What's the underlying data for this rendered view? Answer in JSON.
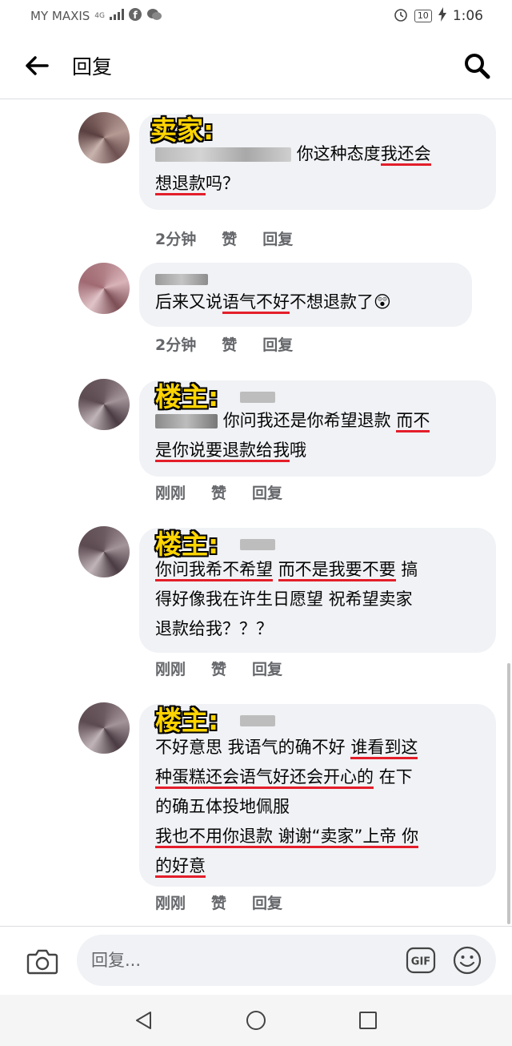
{
  "status_bar": {
    "carrier": "MY MAXIS",
    "network": "4G",
    "battery": "10",
    "time": "1:06"
  },
  "header": {
    "title": "回复",
    "back_icon": "arrow-left-icon",
    "search_icon": "search-icon"
  },
  "comments": [
    {
      "label": "卖家:",
      "text_plain_1": "你这种态度",
      "text_ul_1": "我还会",
      "text_ul_2": "想退款",
      "text_plain_2": "吗？",
      "time": "2分钟",
      "like": "赞",
      "reply": "回复"
    },
    {
      "label": "",
      "text_plain_1": "后来又说",
      "text_ul_1": "语气不好",
      "text_plain_2": "不想退款了",
      "emoji": "😲",
      "time": "2分钟",
      "like": "赞",
      "reply": "回复"
    },
    {
      "label": "楼主:",
      "text_plain_1": "你问我还是你希望退款 ",
      "text_ul_1": "而不",
      "text_ul_2": "是你说要退款给我",
      "text_plain_2": "哦",
      "time": "刚刚",
      "like": "赞",
      "reply": "回复"
    },
    {
      "label": "楼主:",
      "text_ul_1": "你问我希不希望",
      "text_plain_1": " ",
      "text_ul_2": "而不是我要不要",
      "text_plain_2": " 搞",
      "line2": "得好像我在许生日愿望 祝希望卖家",
      "line3": "退款给我？？？",
      "time": "刚刚",
      "like": "赞",
      "reply": "回复"
    },
    {
      "label": "楼主:",
      "line1_plain": "不好意思 我语气的确不好 ",
      "line1_ul": "谁看到这",
      "line2_ul": "种蛋糕还会语气好还会开心的",
      "line2_plain": " 在下",
      "line3": "的确五体投地佩服",
      "line4_ul": "我也不用你退款 谢谢“卖家”上帝 你",
      "line5_ul": "的好意",
      "time": "刚刚",
      "like": "赞",
      "reply": "回复"
    }
  ],
  "composer": {
    "placeholder": "回复...",
    "gif_label": "GIF"
  },
  "colors": {
    "bubble": "#f0f2f5",
    "underline": "#e41e2a",
    "label_yellow": "#ffd400",
    "meta_gray": "#65676b"
  }
}
